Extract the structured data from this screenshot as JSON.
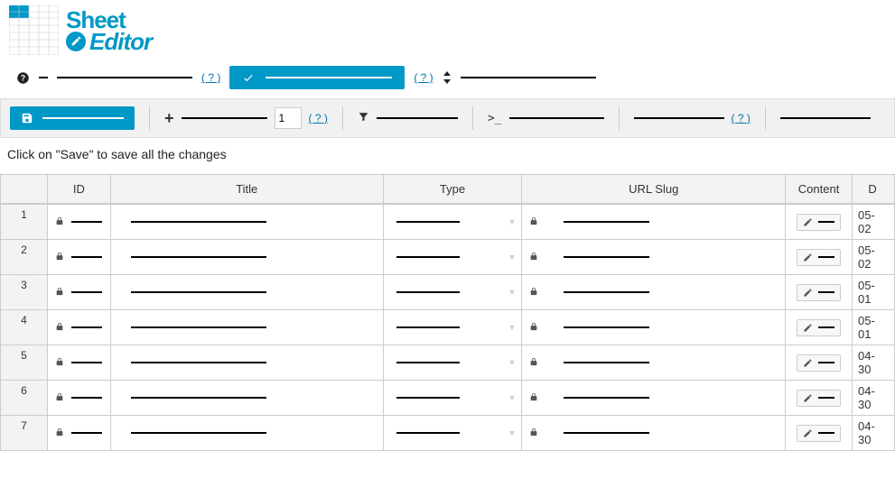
{
  "logo": {
    "line1": "Sheet",
    "line2": "Editor"
  },
  "toolbar2": {
    "rows_input_value": "1"
  },
  "help_link_text": "( ? )",
  "instruction": "Click on \"Save\" to save all the changes",
  "columns": {
    "rownum": "",
    "id": "ID",
    "title": "Title",
    "type": "Type",
    "slug": "URL Slug",
    "content": "Content",
    "date": "D"
  },
  "rows": [
    {
      "n": "1",
      "date": "05-02"
    },
    {
      "n": "2",
      "date": "05-02"
    },
    {
      "n": "3",
      "date": "05-01"
    },
    {
      "n": "4",
      "date": "05-01"
    },
    {
      "n": "5",
      "date": "04-30"
    },
    {
      "n": "6",
      "date": "04-30"
    },
    {
      "n": "7",
      "date": "04-30"
    }
  ]
}
